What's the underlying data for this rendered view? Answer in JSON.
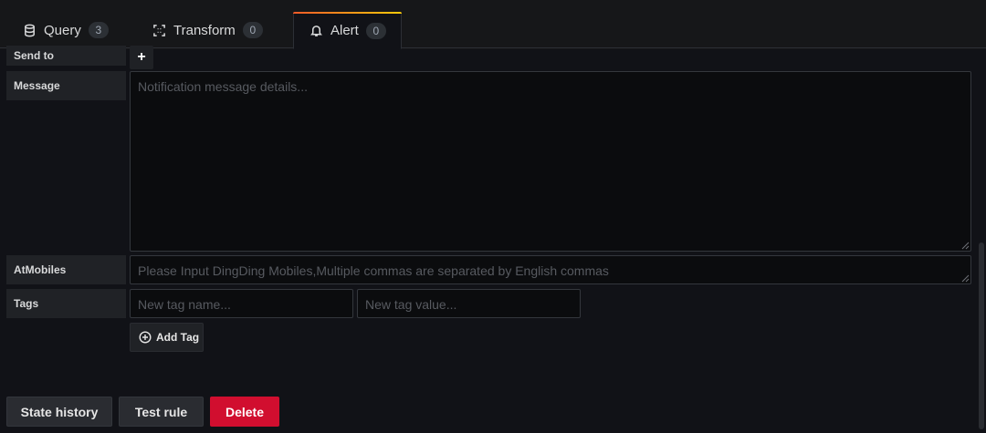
{
  "tabs": [
    {
      "label": "Query",
      "count": "3",
      "icon": "database-icon"
    },
    {
      "label": "Transform",
      "count": "0",
      "icon": "transform-icon"
    },
    {
      "label": "Alert",
      "count": "0",
      "icon": "bell-icon",
      "active": true
    }
  ],
  "form": {
    "send_to_label": "Send to",
    "send_to_add": "+",
    "message_label": "Message",
    "message_placeholder": "Notification message details...",
    "atmobiles_label": "AtMobiles",
    "atmobiles_placeholder": "Please Input DingDing Mobiles,Multiple commas are separated by English commas",
    "tags_label": "Tags",
    "tag_name_placeholder": "New tag name...",
    "tag_value_placeholder": "New tag value...",
    "add_tag_label": "Add Tag"
  },
  "actions": {
    "state_history": "State history",
    "test_rule": "Test rule",
    "delete": "Delete"
  },
  "colors": {
    "active_tab_gradient": [
      "#f05a28",
      "#fbca0a"
    ],
    "danger": "#d10e2f"
  }
}
